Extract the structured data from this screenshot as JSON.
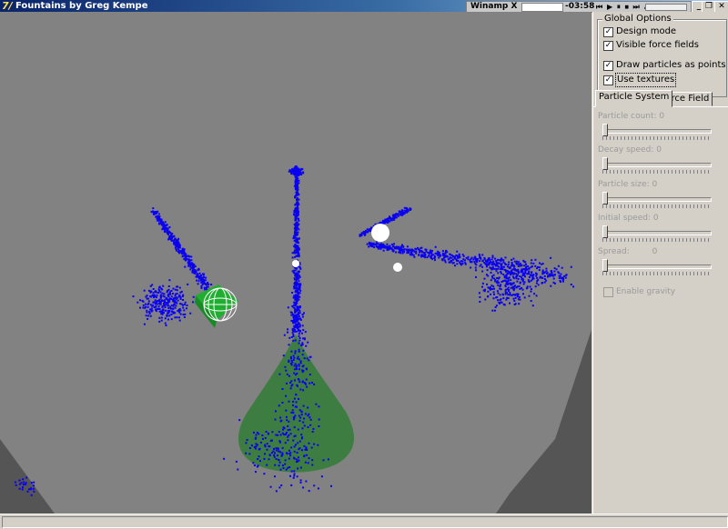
{
  "window": {
    "title": "Fountains by Greg Kempe",
    "icon": "app-icon",
    "app_icon_glyph": "7/",
    "buttons": {
      "minimize": "_",
      "restore": "❐",
      "close": "✕"
    }
  },
  "winamp": {
    "title": "Winamp X",
    "time": "-03:58",
    "controls": "⏮ ▶ ⏸ ⏹ ⏭ ⏏"
  },
  "global_options": {
    "legend": "Global Options",
    "items": [
      {
        "label": "Design mode",
        "checked": true
      },
      {
        "label": "Visible force fields",
        "checked": true
      },
      {
        "label": "Draw particles as points",
        "checked": true
      },
      {
        "label": "Use textures",
        "checked": true
      }
    ]
  },
  "tabs": [
    {
      "label": "Particle System",
      "active": true
    },
    {
      "label": "Force Field",
      "active": false
    }
  ],
  "params": [
    {
      "label": "Particle count:",
      "value": "0"
    },
    {
      "label": "Decay speed:",
      "value": "0"
    },
    {
      "label": "Particle size:",
      "value": "0"
    },
    {
      "label": "Initial speed:",
      "value": "0"
    },
    {
      "label": "Spread:",
      "value": "0"
    }
  ],
  "gravity": {
    "label": "Enable gravity",
    "checked": false
  },
  "colors": {
    "particle": "#0a00f0",
    "cone": "#3e7d42",
    "sphere": "#ffffff",
    "cube": "#1fae30",
    "background": "#828282",
    "floor": "#555555"
  }
}
